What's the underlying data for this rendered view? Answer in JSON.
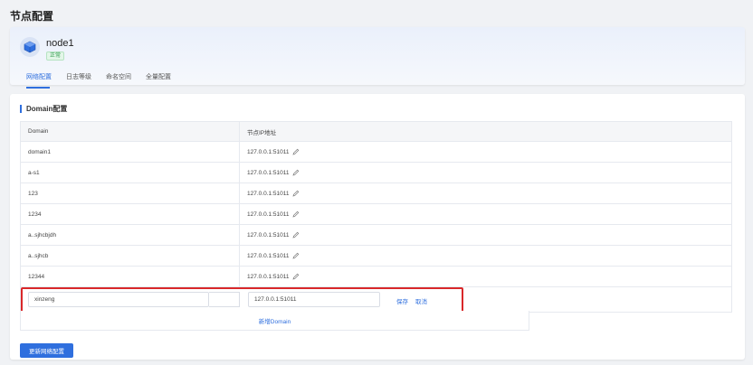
{
  "page": {
    "title": "节点配置"
  },
  "node": {
    "name": "node1",
    "status": "正常"
  },
  "tabs": [
    {
      "label": "网络配置",
      "active": true
    },
    {
      "label": "日志等级",
      "active": false
    },
    {
      "label": "命名空间",
      "active": false
    },
    {
      "label": "全量配置",
      "active": false
    }
  ],
  "section": {
    "title": "Domain配置"
  },
  "table": {
    "headers": [
      "Domain",
      "节点IP地址"
    ],
    "rows": [
      {
        "domain": "domain1",
        "ip": "127.0.0.1:51011"
      },
      {
        "domain": "a-s1",
        "ip": "127.0.0.1:51011"
      },
      {
        "domain": "123",
        "ip": "127.0.0.1:51011"
      },
      {
        "domain": "1234",
        "ip": "127.0.0.1:51011"
      },
      {
        "domain": "a..sjhcbjdh",
        "ip": "127.0.0.1:51011"
      },
      {
        "domain": "a..sjhcb",
        "ip": "127.0.0.1:51011"
      },
      {
        "domain": "12344",
        "ip": "127.0.0.1:51011"
      }
    ]
  },
  "new_row": {
    "domain_value": "xinzeng",
    "ip_value": "127.0.0.1:51011",
    "save_label": "保存",
    "cancel_label": "取消"
  },
  "add_domain_label": "新增Domain",
  "update_button_label": "更新网络配置",
  "colors": {
    "accent": "#2f6fde",
    "highlight": "#d9282a",
    "status_green": "#2e9b4c"
  },
  "icons": {
    "node": "cube-icon",
    "edit": "pencil-icon"
  }
}
